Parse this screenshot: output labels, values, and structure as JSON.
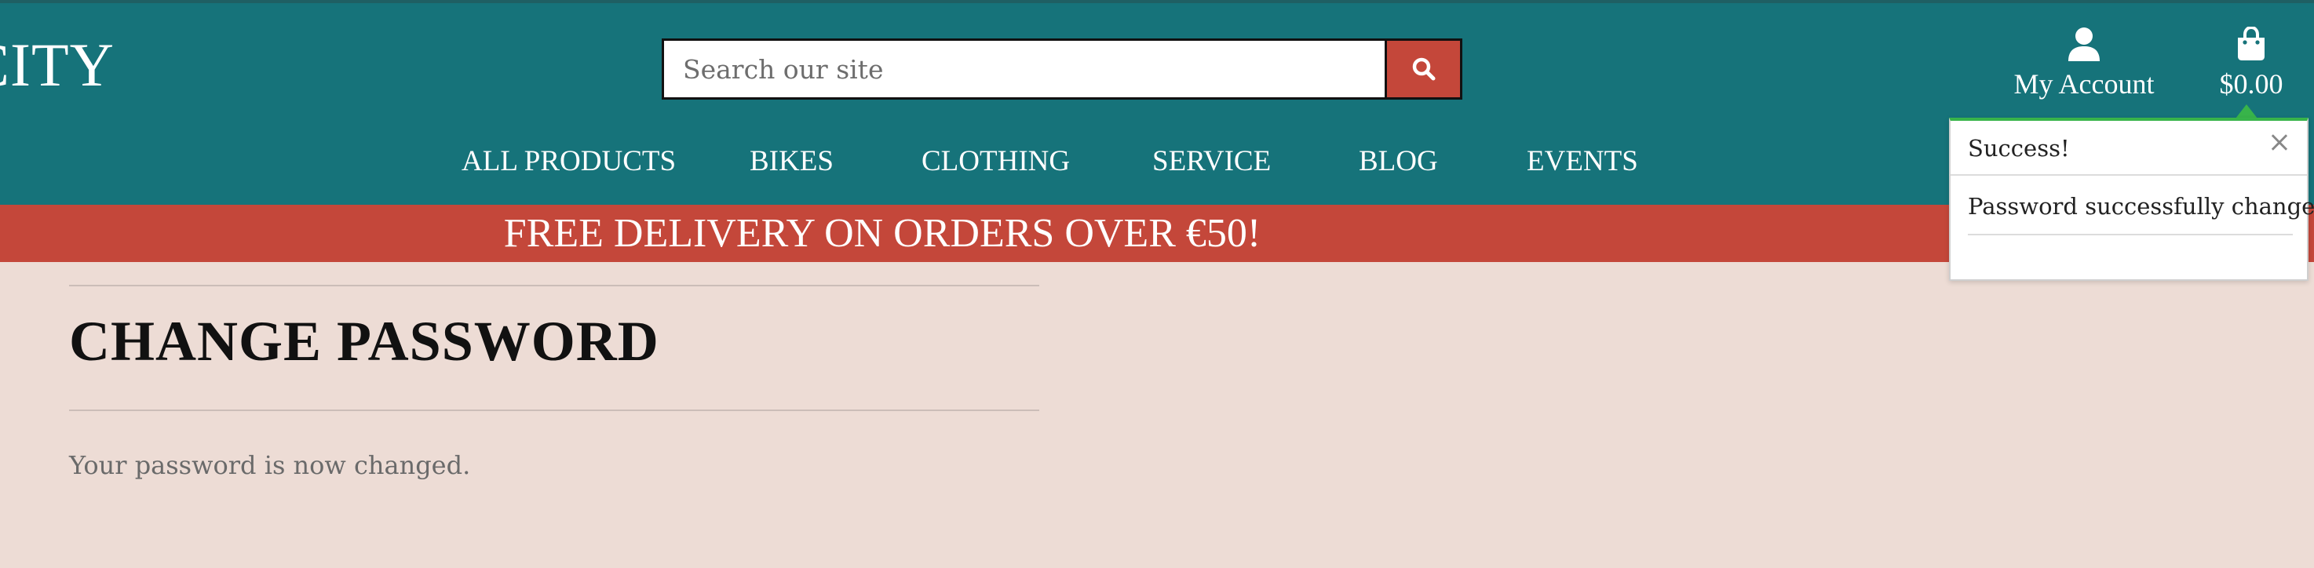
{
  "header": {
    "logo_text": "CITY",
    "search": {
      "placeholder": "Search our site",
      "value": ""
    },
    "account_label": "My Account",
    "cart_total": "$0.00"
  },
  "nav": {
    "items": [
      "ALL PRODUCTS",
      "BIKES",
      "CLOTHING",
      "SERVICE",
      "BLOG",
      "EVENTS"
    ]
  },
  "banner": {
    "text": "FREE DELIVERY ON ORDERS OVER €50!"
  },
  "main": {
    "title": "CHANGE PASSWORD",
    "message": "Your password is now changed."
  },
  "toast": {
    "title": "Success!",
    "body": "Password successfully changed.",
    "close_symbol": "×"
  },
  "colors": {
    "header_bg": "#16737a",
    "banner_bg": "#c4473a",
    "page_bg": "#eddcd5",
    "toast_accent": "#38b44a"
  }
}
